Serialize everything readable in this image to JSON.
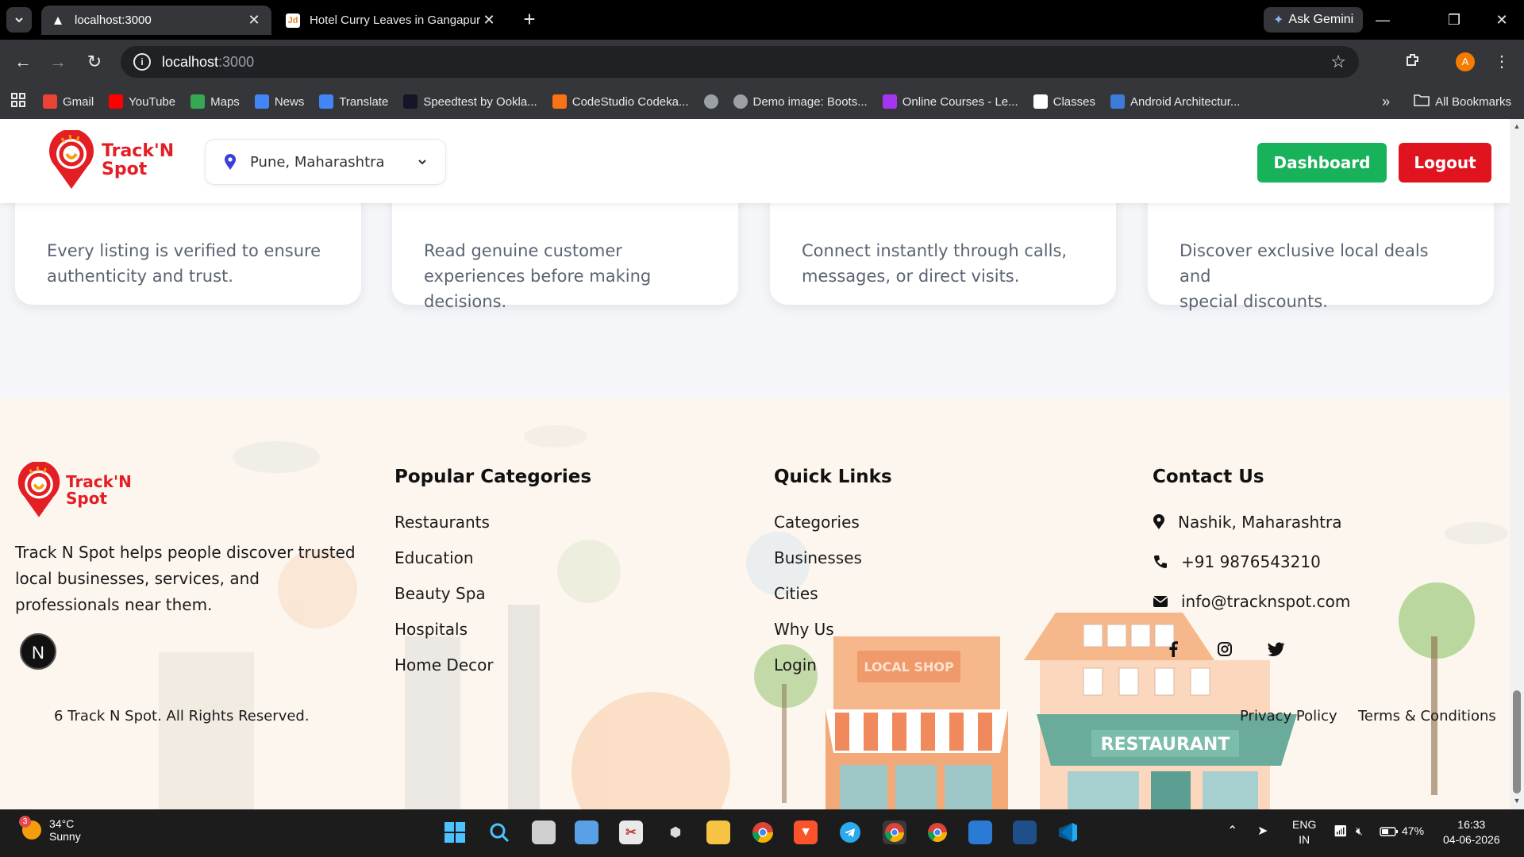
{
  "browser": {
    "tabs": [
      {
        "title": "localhost:3000",
        "active": true
      },
      {
        "title": "Hotel Curry Leaves in Gangapur",
        "active": false
      }
    ],
    "gemini_label": "Ask Gemini",
    "url_host": "localhost",
    "url_port": ":3000",
    "profile_initial": "A",
    "bookmarks": [
      {
        "label": "Gmail",
        "icon": "gmail-icon",
        "color": "#ea4335"
      },
      {
        "label": "YouTube",
        "icon": "youtube-icon",
        "color": "#ff0000"
      },
      {
        "label": "Maps",
        "icon": "maps-icon",
        "color": "#34a853"
      },
      {
        "label": "News",
        "icon": "news-icon",
        "color": "#4285f4"
      },
      {
        "label": "Translate",
        "icon": "translate-icon",
        "color": "#4285f4"
      },
      {
        "label": "Speedtest by Ookla...",
        "icon": "speedtest-icon",
        "color": "#141526"
      },
      {
        "label": "CodeStudio Codeka...",
        "icon": "codestudio-icon",
        "color": "#f97316"
      },
      {
        "label": "",
        "icon": "globe-icon",
        "color": "#9aa0a6"
      },
      {
        "label": "Demo image: Boots...",
        "icon": "globe-icon",
        "color": "#9aa0a6"
      },
      {
        "label": "Online Courses - Le...",
        "icon": "udemy-icon",
        "color": "#a435f0"
      },
      {
        "label": "Classes",
        "icon": "google-icon",
        "color": "#ffffff"
      },
      {
        "label": "Android Architectur...",
        "icon": "android-icon",
        "color": "#3d7bd9"
      }
    ],
    "all_bookmarks_label": "All Bookmarks"
  },
  "header": {
    "logo_line1": "Track'N",
    "logo_line2": "Spot",
    "location": "Pune, Maharashtra",
    "dashboard_label": "Dashboard",
    "logout_label": "Logout"
  },
  "features": [
    {
      "line1": "Every listing is verified to ensure",
      "line2": "authenticity and trust.",
      "line3": ""
    },
    {
      "line1": "Read genuine customer",
      "line2": "experiences before making",
      "line3": "decisions."
    },
    {
      "line1": "Connect instantly through calls,",
      "line2": "messages, or direct visits.",
      "line3": ""
    },
    {
      "line1": "Discover exclusive local deals and",
      "line2": "special discounts.",
      "line3": ""
    }
  ],
  "footer": {
    "about": "Track N Spot helps people discover trusted local businesses, services, and professionals near them.",
    "categories_heading": "Popular Categories",
    "categories": [
      "Restaurants",
      "Education",
      "Beauty Spa",
      "Hospitals",
      "Home Decor"
    ],
    "quick_links_heading": "Quick Links",
    "quick_links": [
      "Categories",
      "Businesses",
      "Cities",
      "Why Us",
      "Login"
    ],
    "contact_heading": "Contact Us",
    "address": "Nashik, Maharashtra",
    "phone": "+91 9876543210",
    "email": "info@tracknspot.com",
    "copyright": "6 Track N Spot. All Rights Reserved.",
    "privacy": "Privacy Policy",
    "terms": "Terms & Conditions",
    "illustration_shop_sign": "LOCAL SHOP",
    "illustration_restaurant_sign": "RESTAURANT"
  },
  "floating_badge": "N",
  "taskbar": {
    "temperature": "34°C",
    "weather": "Sunny",
    "weather_badge": "3",
    "lang_top": "ENG",
    "lang_bottom": "IN",
    "battery": "47%",
    "time": "16:33",
    "date": "04-06-2026"
  },
  "colors": {
    "brand_red": "#e31e24",
    "dashboard_green": "#18b25b",
    "logout_red": "#e0141e",
    "footer_bg": "#fdf6ee",
    "location_pin": "#3b3fd8"
  }
}
